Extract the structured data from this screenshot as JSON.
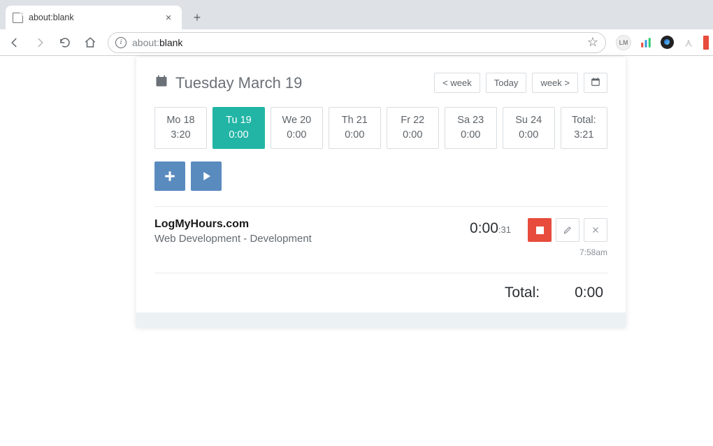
{
  "browser": {
    "tab_title": "about:blank",
    "url_prefix": "about:",
    "url_rest": "blank"
  },
  "header": {
    "title": "Tuesday March 19",
    "nav": {
      "prev": "< week",
      "today": "Today",
      "next": "week >"
    }
  },
  "days": [
    {
      "label": "Mo 18",
      "time": "3:20"
    },
    {
      "label": "Tu 19",
      "time": "0:00"
    },
    {
      "label": "We 20",
      "time": "0:00"
    },
    {
      "label": "Th 21",
      "time": "0:00"
    },
    {
      "label": "Fr 22",
      "time": "0:00"
    },
    {
      "label": "Sa 23",
      "time": "0:00"
    },
    {
      "label": "Su 24",
      "time": "0:00"
    }
  ],
  "week_total": {
    "label": "Total:",
    "time": "3:21"
  },
  "entry": {
    "project": "LogMyHours.com",
    "task": "Web Development - Development",
    "elapsed_main": "0:00",
    "elapsed_seconds": ":31",
    "started_at": "7:58am"
  },
  "footer": {
    "total_label": "Total:",
    "total_value": "0:00"
  }
}
